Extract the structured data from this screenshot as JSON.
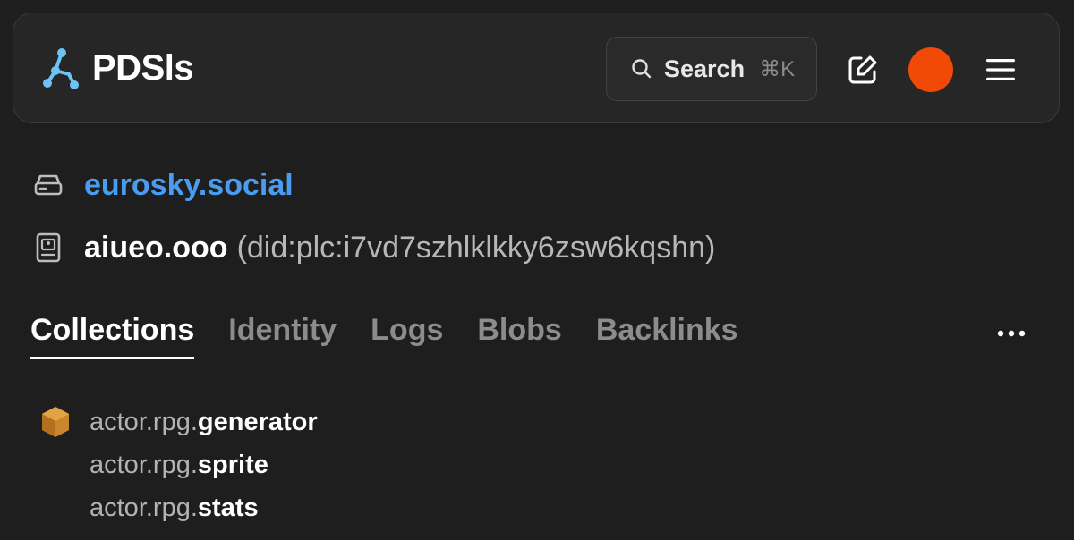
{
  "header": {
    "brand_name": "PDSls",
    "search_label": "Search",
    "search_shortcut": "⌘K",
    "avatar_color": "#f04a06",
    "icons": [
      "edit-icon",
      "menu-icon",
      "search-icon"
    ]
  },
  "repo": {
    "server": "eurosky.social",
    "handle": "aiueo.ooo",
    "did": "(did:plc:i7vd7szhlklkky6zsw6kqshn)"
  },
  "tabs": [
    {
      "label": "Collections",
      "active": true
    },
    {
      "label": "Identity",
      "active": false
    },
    {
      "label": "Logs",
      "active": false
    },
    {
      "label": "Blobs",
      "active": false
    },
    {
      "label": "Backlinks",
      "active": false
    }
  ],
  "more_label": "…",
  "collections": [
    {
      "ns": "actor.rpg.",
      "name": "generator"
    },
    {
      "ns": "actor.rpg.",
      "name": "sprite"
    },
    {
      "ns": "actor.rpg.",
      "name": "stats"
    }
  ],
  "colors": {
    "link": "#4a9cf0",
    "accent": "#f04a06",
    "cube_icon": "#d08a2a"
  }
}
